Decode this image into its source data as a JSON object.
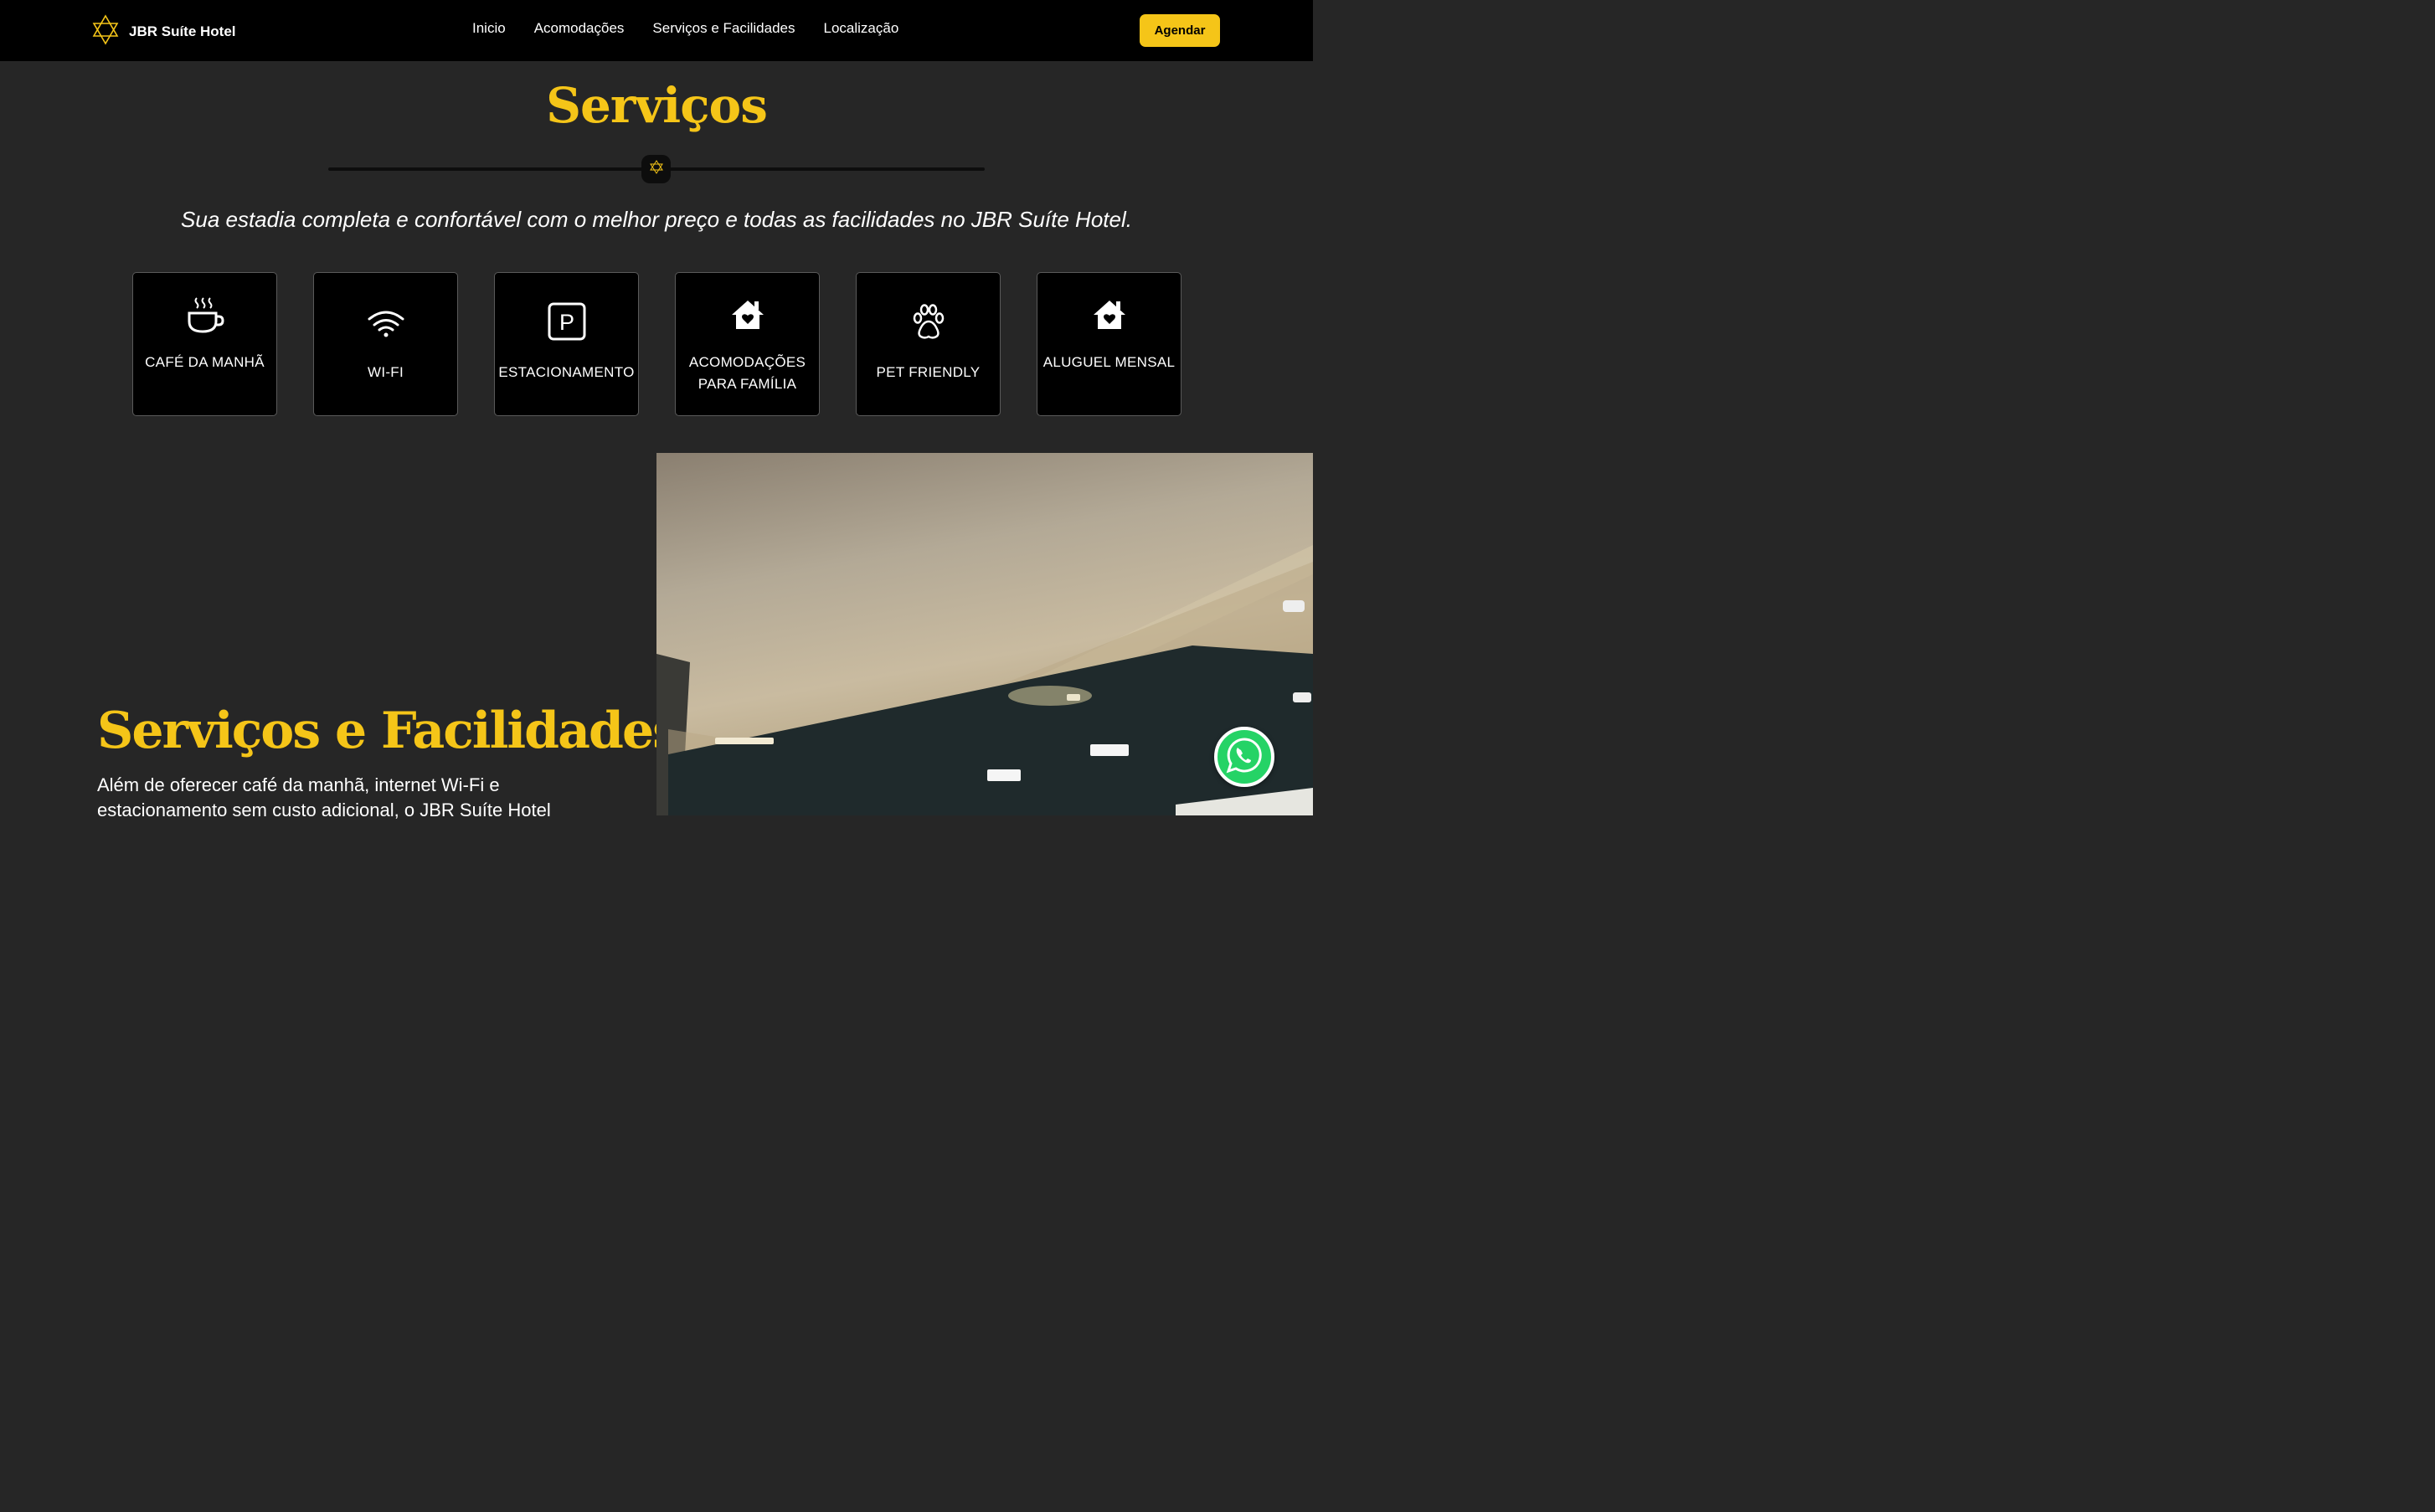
{
  "header": {
    "brand": "JBR Suíte Hotel",
    "logo_icon": "star-of-david-icon",
    "nav": [
      "Inicio",
      "Acomodações",
      "Serviços e Facilidades",
      "Localização"
    ],
    "cta": "Agendar",
    "cta_color": "#f5c518"
  },
  "services": {
    "title": "Serviços",
    "tagline": "Sua estadia completa e confortável com o melhor preço e todas as facilidades no JBR Suíte Hotel.",
    "cards": [
      {
        "label": "CAFÉ DA MANHÃ",
        "icon": "coffee-cup-icon"
      },
      {
        "label": "WI-FI",
        "icon": "wifi-icon"
      },
      {
        "label": "ESTACIONAMENTO",
        "icon": "parking-icon"
      },
      {
        "label": "ACOMODAÇÕES PARA FAMÍLIA",
        "icon": "house-heart-icon"
      },
      {
        "label": "PET FRIENDLY",
        "icon": "paw-icon"
      },
      {
        "label": "ALUGUEL MENSAL",
        "icon": "house-heart-icon"
      }
    ]
  },
  "feature": {
    "title": "Serviços e Facilidades",
    "text": "Além de oferecer café da manhã, internet Wi-Fi e estacionamento sem custo adicional, o JBR Suíte Hotel"
  },
  "floating": {
    "whatsapp_icon": "whatsapp-icon"
  },
  "colors": {
    "accent": "#f5c518",
    "background": "#262626",
    "navbar": "#000000"
  }
}
